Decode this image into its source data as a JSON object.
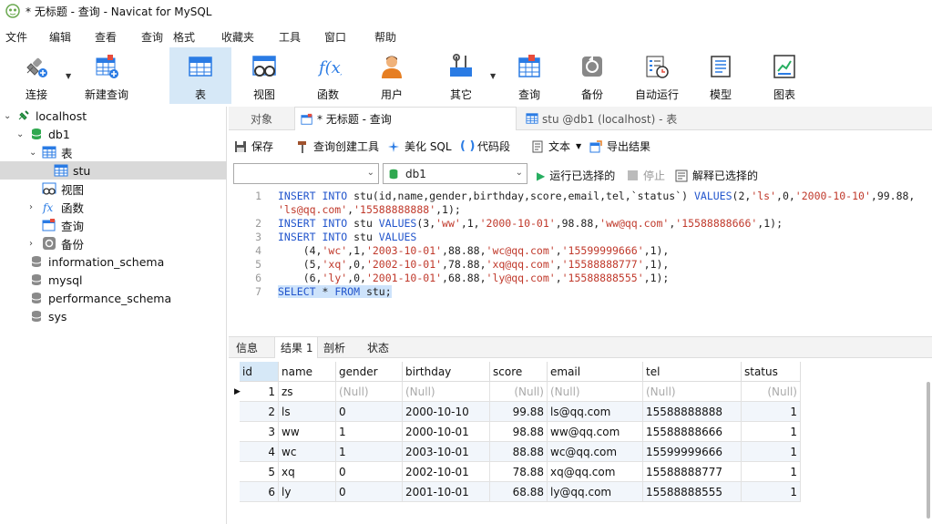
{
  "window": {
    "title": "* 无标题 - 查询 - Navicat for MySQL"
  },
  "menu": [
    "文件",
    "编辑",
    "查看",
    "查询",
    "格式",
    "收藏夹",
    "工具",
    "窗口",
    "帮助"
  ],
  "toolbar": [
    {
      "label": "连接",
      "icon": "connection-plug-icon"
    },
    {
      "label": "新建查询",
      "icon": "new-query-icon"
    },
    {
      "label": "表",
      "icon": "table-icon"
    },
    {
      "label": "视图",
      "icon": "view-icon"
    },
    {
      "label": "函数",
      "icon": "function-icon"
    },
    {
      "label": "用户",
      "icon": "user-icon"
    },
    {
      "label": "其它",
      "icon": "tools-icon"
    },
    {
      "label": "查询",
      "icon": "query-icon"
    },
    {
      "label": "备份",
      "icon": "backup-icon"
    },
    {
      "label": "自动运行",
      "icon": "auto-run-icon"
    },
    {
      "label": "模型",
      "icon": "model-icon"
    },
    {
      "label": "图表",
      "icon": "chart-icon"
    }
  ],
  "tree": {
    "connection": "localhost",
    "database": "db1",
    "tables_label": "表",
    "table": "stu",
    "views_label": "视图",
    "functions_label": "函数",
    "queries_label": "查询",
    "backups_label": "备份",
    "other_dbs": [
      "information_schema",
      "mysql",
      "performance_schema",
      "sys"
    ]
  },
  "tabs": [
    "对象",
    "* 无标题 - 查询",
    "stu @db1 (localhost) - 表"
  ],
  "querybar": {
    "save": "保存",
    "builder": "查询创建工具",
    "beautify": "美化 SQL",
    "snippet": "代码段",
    "text": "文本",
    "export": "导出结果"
  },
  "runbar": {
    "connection_value": "",
    "database_value": "db1",
    "run_selected": "运行已选择的",
    "stop": "停止",
    "explain": "解释已选择的"
  },
  "editor": {
    "line_numbers": [
      "1",
      "",
      "2",
      "3",
      "4",
      "5",
      "6",
      "7"
    ],
    "lines": [
      "INSERT INTO stu(id,name,gender,birthday,score,email,tel,`status`) VALUES(2,'ls',0,'2000-10-10',99.88,",
      "'ls@qq.com','15588888888',1);",
      "INSERT INTO stu VALUES(3,'ww',1,'2000-10-01',98.88,'ww@qq.com','15588888666',1);",
      "INSERT INTO stu VALUES",
      "    (4,'wc',1,'2003-10-01',88.88,'wc@qq.com','15599999666',1),",
      "    (5,'xq',0,'2002-10-01',78.88,'xq@qq.com','15588888777',1),",
      "    (6,'ly',0,'2001-10-01',68.88,'ly@qq.com','15588888555',1);",
      "SELECT * FROM stu;"
    ]
  },
  "result_tabs": [
    "信息",
    "结果 1",
    "剖析",
    "状态"
  ],
  "grid": {
    "columns": [
      "id",
      "name",
      "gender",
      "birthday",
      "score",
      "email",
      "tel",
      "status"
    ],
    "rows": [
      [
        "1",
        "zs",
        "(Null)",
        "(Null)",
        "(Null)",
        "(Null)",
        "(Null)",
        "(Null)"
      ],
      [
        "2",
        "ls",
        "0",
        "2000-10-10",
        "99.88",
        "ls@qq.com",
        "15588888888",
        "1"
      ],
      [
        "3",
        "ww",
        "1",
        "2000-10-01",
        "98.88",
        "ww@qq.com",
        "15588888666",
        "1"
      ],
      [
        "4",
        "wc",
        "1",
        "2003-10-01",
        "88.88",
        "wc@qq.com",
        "15599999666",
        "1"
      ],
      [
        "5",
        "xq",
        "0",
        "2002-10-01",
        "78.88",
        "xq@qq.com",
        "15588888777",
        "1"
      ],
      [
        "6",
        "ly",
        "0",
        "2001-10-01",
        "68.88",
        "ly@qq.com",
        "15588888555",
        "1"
      ]
    ]
  }
}
